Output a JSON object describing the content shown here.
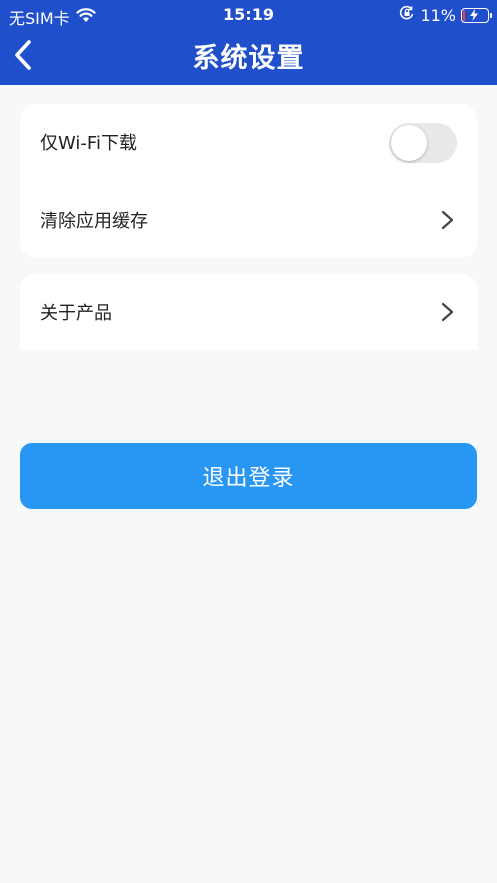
{
  "status_bar": {
    "carrier": "无SIM卡",
    "time": "15:19",
    "battery_percent": "11%",
    "battery_level": 0.11,
    "battery_color": "#ff3b30",
    "icons": [
      "wifi-icon",
      "orientation-lock-icon",
      "battery-icon",
      "charging-bolt-icon"
    ]
  },
  "header": {
    "title": "系统设置",
    "back_icon": "chevron-left-icon",
    "background_color": "#1f4fcb"
  },
  "settings": {
    "wifi_only_download": {
      "label": "仅Wi-Fi下载",
      "enabled": false
    },
    "clear_cache": {
      "label": "清除应用缓存",
      "icon": "chevron-right-icon"
    },
    "about_product": {
      "label": "关于产品",
      "icon": "chevron-right-icon"
    }
  },
  "logout": {
    "label": "退出登录",
    "color": "#2797f3"
  }
}
